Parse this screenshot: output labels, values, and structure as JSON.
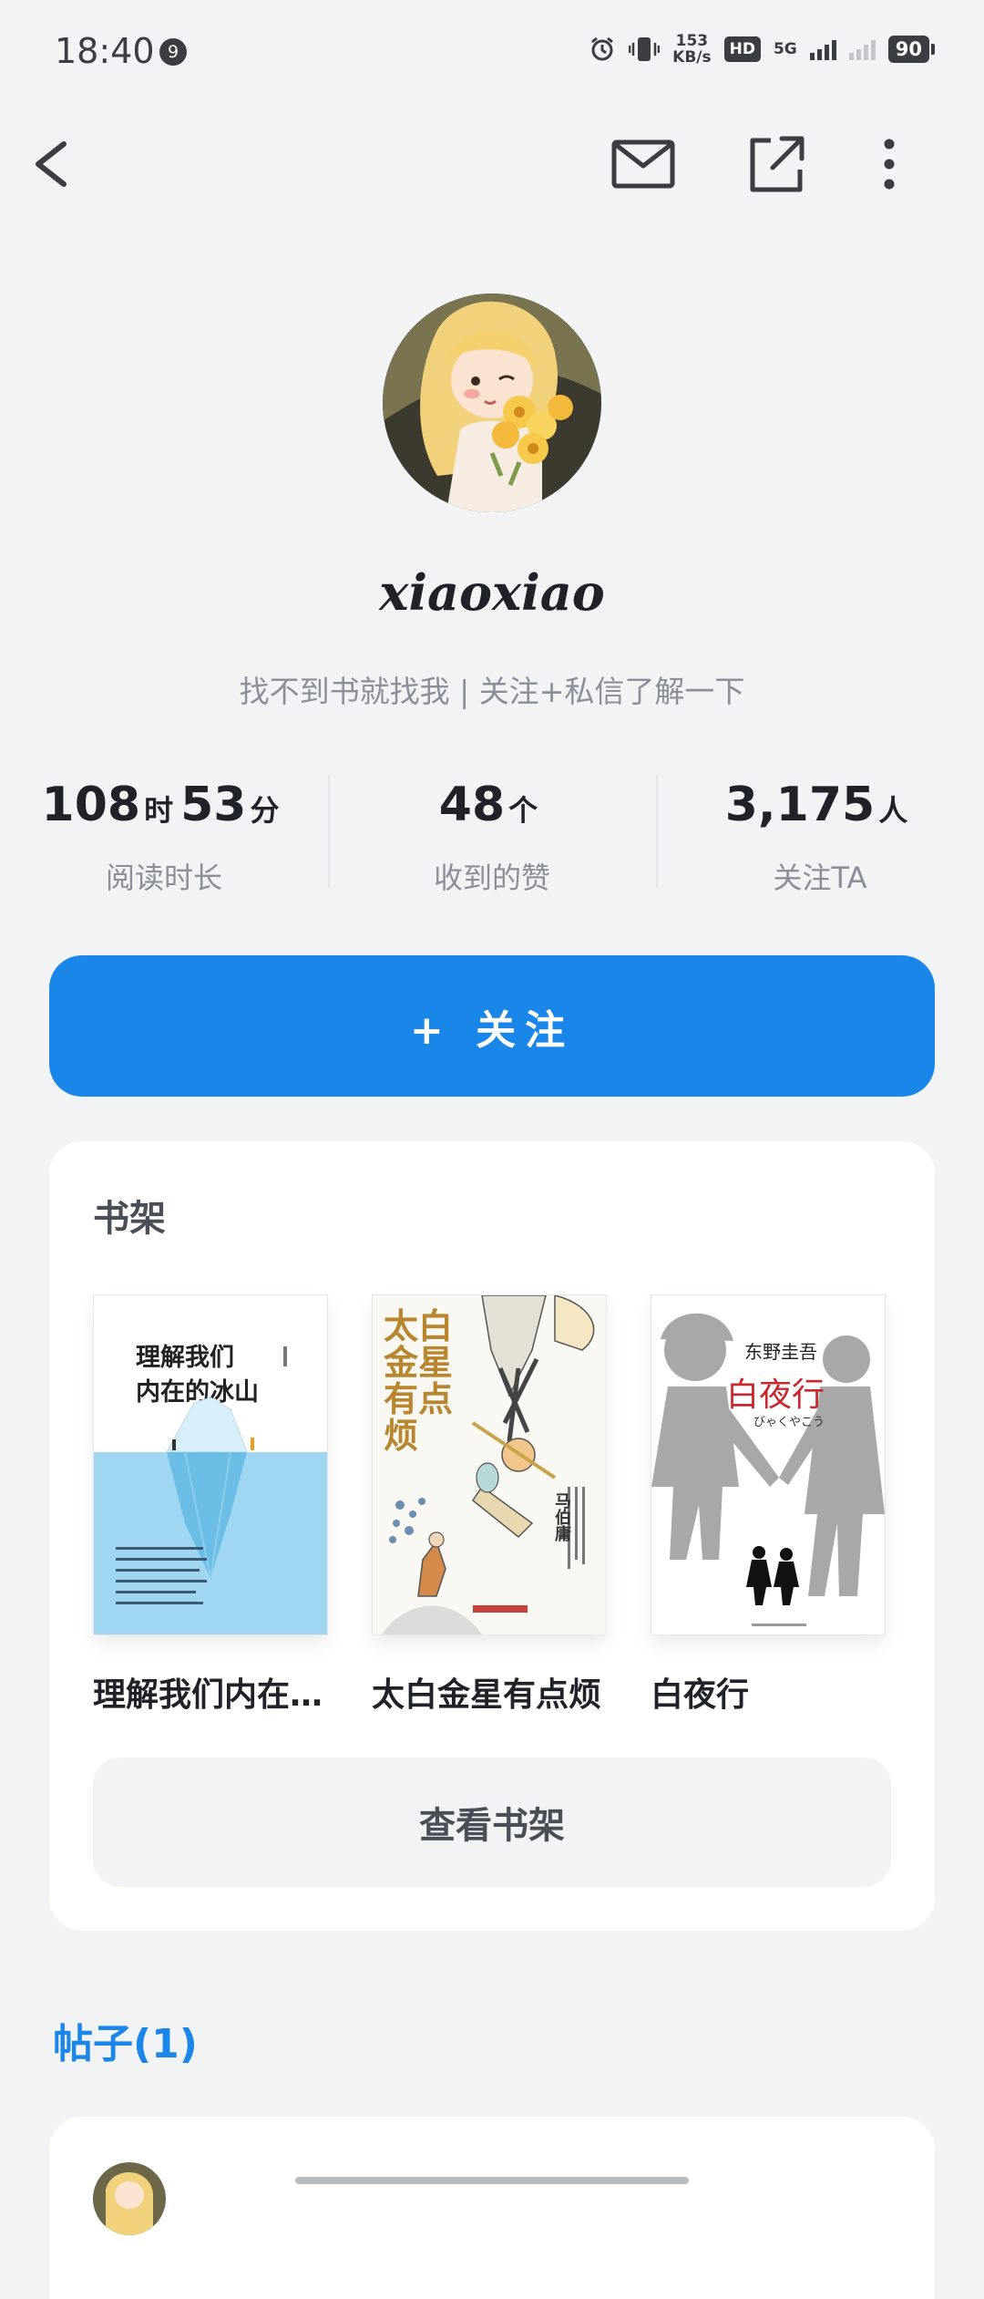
{
  "status_bar": {
    "time": "18:40",
    "notification_count": "9",
    "net_speed_value": "153",
    "net_speed_unit": "KB/s",
    "hd_label": "HD",
    "network_label": "5G",
    "battery": "90"
  },
  "nav": {
    "back_icon": "chevron-left-icon",
    "mail_icon": "mail-icon",
    "share_icon": "share-icon",
    "more_icon": "more-vertical-icon"
  },
  "profile": {
    "username": "xiaoxiao",
    "bio": "找不到书就找我 | 关注+私信了解一下"
  },
  "stats": [
    {
      "value1": "108",
      "unit1": "时",
      "value2": "53",
      "unit2": "分",
      "label": "阅读时长"
    },
    {
      "value1": "48",
      "unit1": "个",
      "label": "收到的赞"
    },
    {
      "value1": "3,175",
      "unit1": "人",
      "label": "关注TA"
    }
  ],
  "follow_button": "+ 关注",
  "bookshelf": {
    "title": "书架",
    "books": [
      {
        "name": "理解我们内在…",
        "cover_title_line1": "理解我们",
        "cover_title_line2": "内在的冰山"
      },
      {
        "name": "太白金星有点烦",
        "cover_title": "太白金星有点烦",
        "cover_author": "马伯庸"
      },
      {
        "name": "白夜行",
        "cover_author": "东野圭吾",
        "cover_title": "白夜行",
        "cover_subtitle": "びゃくやこう"
      }
    ],
    "view_button": "查看书架"
  },
  "posts": {
    "title": "帖子(1)"
  },
  "colors": {
    "accent": "#1a86ea",
    "background": "#f2f3f5",
    "card": "#ffffff"
  }
}
